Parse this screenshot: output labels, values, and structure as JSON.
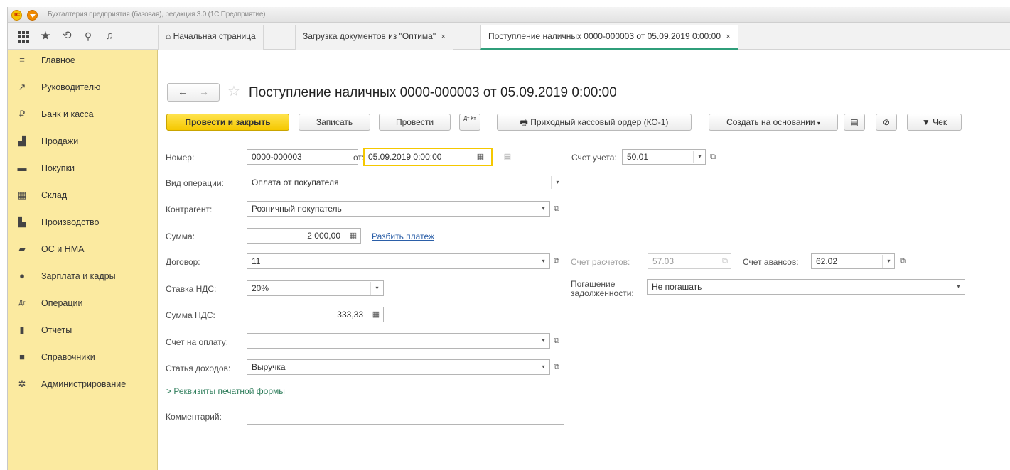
{
  "titlebar": {
    "logo": "1С",
    "title": "Бухгалтерия предприятия (базовая), редакция 3.0  (1С:Предприятие)"
  },
  "toppanel": {
    "icons": [
      "apps-grid-icon",
      "star-icon",
      "history-icon",
      "search-icon",
      "bell-icon"
    ],
    "tabs": [
      {
        "label": "Начальная страница",
        "icon": "home-icon"
      },
      {
        "label": "Загрузка документов из \"Оптима\"",
        "close": "×"
      },
      {
        "label": "Поступление наличных 0000-000003 от 05.09.2019 0:00:00",
        "close": "×",
        "active": true
      }
    ]
  },
  "sidebar": {
    "items": [
      {
        "label": "Главное",
        "icon": "menu-lines-icon",
        "glyph": "≡"
      },
      {
        "label": "Руководителю",
        "icon": "trend-icon",
        "glyph": "↗"
      },
      {
        "label": "Банк и касса",
        "icon": "coin-icon",
        "glyph": "₽"
      },
      {
        "label": "Продажи",
        "icon": "bag-icon",
        "glyph": "▟"
      },
      {
        "label": "Покупки",
        "icon": "cart-icon",
        "glyph": "▬"
      },
      {
        "label": "Склад",
        "icon": "warehouse-icon",
        "glyph": "▦"
      },
      {
        "label": "Производство",
        "icon": "factory-icon",
        "glyph": "▙"
      },
      {
        "label": "ОС и НМА",
        "icon": "truck-icon",
        "glyph": "▰"
      },
      {
        "label": "Зарплата и кадры",
        "icon": "person-icon",
        "glyph": "●"
      },
      {
        "label": "Операции",
        "icon": "dt-kt-icon",
        "glyph": "Дт"
      },
      {
        "label": "Отчеты",
        "icon": "bar-chart-icon",
        "glyph": "▮"
      },
      {
        "label": "Справочники",
        "icon": "book-icon",
        "glyph": "■"
      },
      {
        "label": "Администрирование",
        "icon": "gear-icon",
        "glyph": "✲"
      }
    ]
  },
  "document": {
    "nav_back": "←",
    "nav_forward": "→",
    "star": "☆",
    "title": "Поступление наличных 0000-000003 от 05.09.2019 0:00:00"
  },
  "toolbar": {
    "post_close": "Провести и закрыть",
    "save": "Записать",
    "post": "Провести",
    "dtkt": "Дт Кт",
    "print": "Приходный кассовый ордер (КО-1)",
    "create_based": "Создать на основании",
    "receipt": "Чек"
  },
  "form": {
    "number_label": "Номер:",
    "number_value": "0000-000003",
    "date_label": "от:",
    "date_value": "05.09.2019  0:00:00",
    "account_label": "Счет учета:",
    "account_value": "50.01",
    "operation_label": "Вид операции:",
    "operation_value": "Оплата от покупателя",
    "counterparty_label": "Контрагент:",
    "counterparty_value": "Розничный покупатель",
    "sum_label": "Сумма:",
    "sum_value": "2 000,00",
    "split_link": "Разбить платеж",
    "contract_label": "Договор:",
    "contract_value": "11",
    "settlement_label": "Счет расчетов:",
    "settlement_value": "57.03",
    "advance_label": "Счет авансов:",
    "advance_value": "62.02",
    "vat_rate_label": "Ставка НДС:",
    "vat_rate_value": "20%",
    "debt_label_1": "Погашение",
    "debt_label_2": "задолженности:",
    "debt_value": "Не погашать",
    "vat_sum_label": "Сумма НДС:",
    "vat_sum_value": "333,33",
    "invoice_label": "Счет на оплату:",
    "invoice_value": "",
    "income_label": "Статья доходов:",
    "income_value": "Выручка",
    "print_details": "Реквизиты печатной формы",
    "comment_label": "Комментарий:",
    "comment_value": ""
  }
}
